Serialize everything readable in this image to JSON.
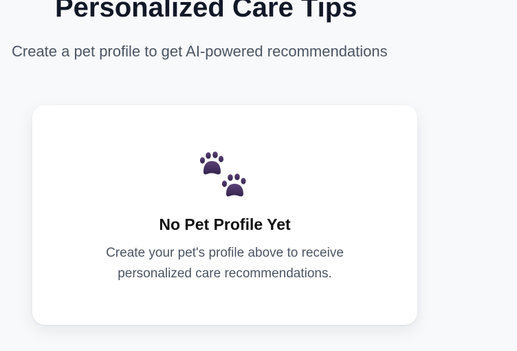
{
  "header": {
    "title": "Personalized Care Tips",
    "subtitle": "Create a pet profile to get AI-powered recommendations"
  },
  "empty_state": {
    "icon": "paw-prints-icon",
    "heading": "No Pet Profile Yet",
    "message": "Create your pet's profile above to receive personalized care recommendations."
  },
  "colors": {
    "page_background": "#f8f9fb",
    "card_background": "#ffffff",
    "title_text": "#111827",
    "secondary_text": "#4b5563",
    "paw_icon": "#4a3466"
  }
}
